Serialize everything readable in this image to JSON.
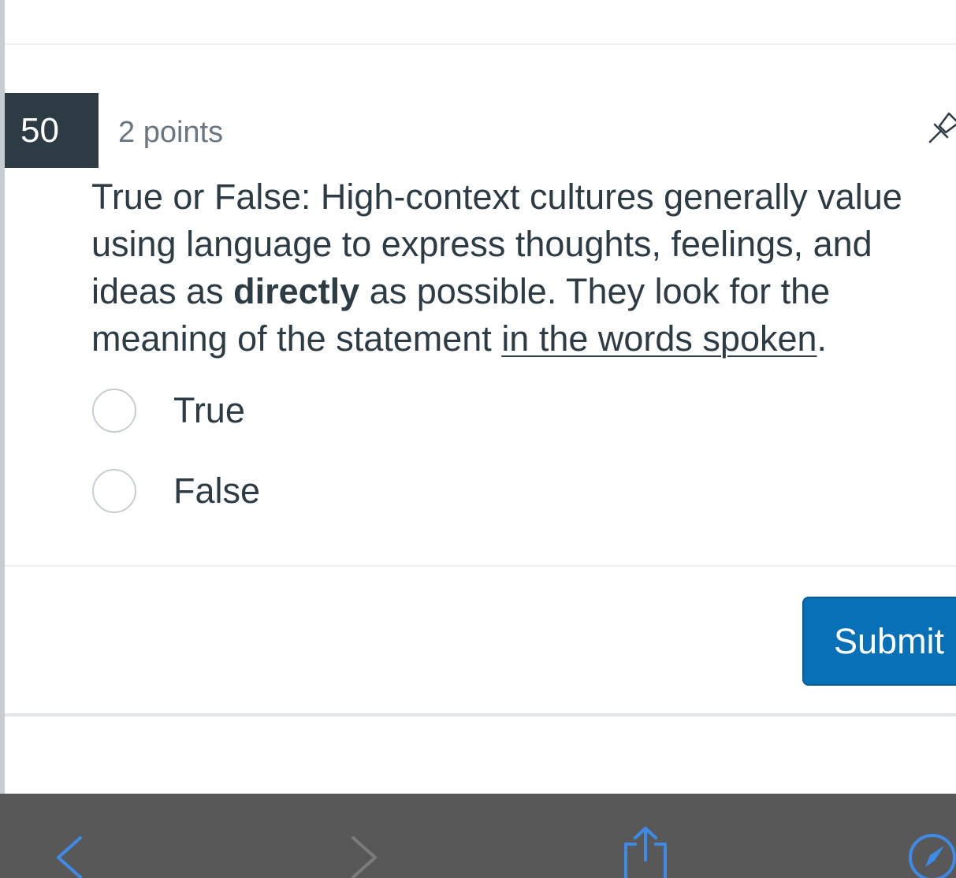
{
  "question": {
    "number": "50",
    "points": "2 points",
    "text_part1": "True or False: High-context cultures generally value using language to express thoughts, feelings, and ideas as ",
    "text_bold": "directly",
    "text_part2": " as possible. They look for the meaning of the statement ",
    "text_underline": "in the words spoken",
    "text_part3": ".",
    "options": [
      {
        "label": "True"
      },
      {
        "label": "False"
      }
    ]
  },
  "actions": {
    "submit_label": "Submit"
  },
  "icons": {
    "pin": "pin-icon",
    "back": "chevron-left-icon",
    "forward": "chevron-right-icon",
    "share": "share-icon",
    "safari": "compass-icon"
  },
  "colors": {
    "question_badge": "#2d3b45",
    "submit_button": "#0770b7",
    "toolbar": "#585858",
    "toolbar_icon": "#3e8ae6"
  }
}
